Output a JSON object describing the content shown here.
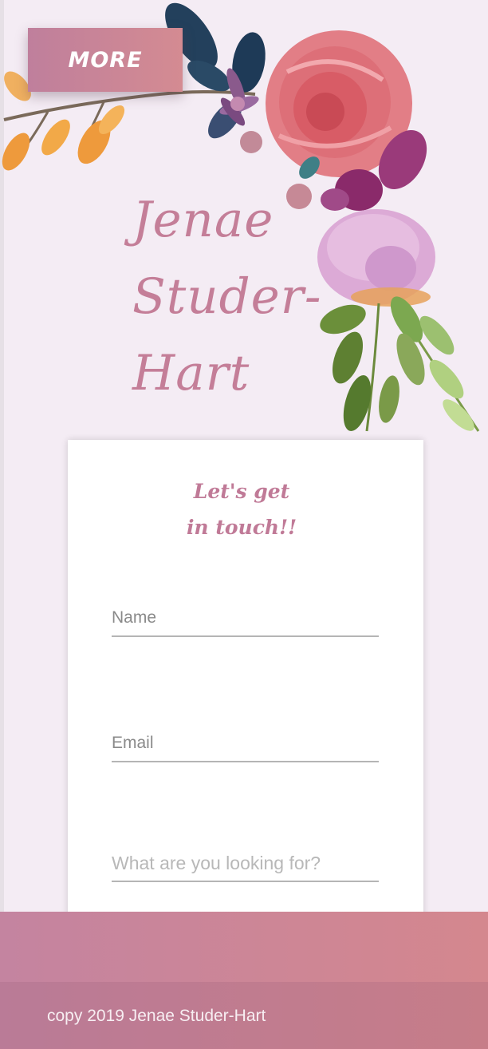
{
  "nav": {
    "more_label": "MORE"
  },
  "header": {
    "title": "Jenae Studer-Hart",
    "title_lines": [
      "Jenae",
      "Studer-",
      "Hart"
    ]
  },
  "contact_form": {
    "heading_lines": [
      "Let's get",
      "in touch!!"
    ],
    "fields": [
      {
        "placeholder": "Name",
        "value": ""
      },
      {
        "placeholder": "Email",
        "value": ""
      },
      {
        "placeholder": "What are you looking for?",
        "value": ""
      }
    ]
  },
  "footer": {
    "copyright": "copy 2019 Jenae Studer-Hart"
  },
  "colors": {
    "accent_pink": "#c47e98",
    "button_gradient": [
      "#bf7f9c",
      "#d48b92"
    ],
    "background": "#f4ecf4"
  }
}
